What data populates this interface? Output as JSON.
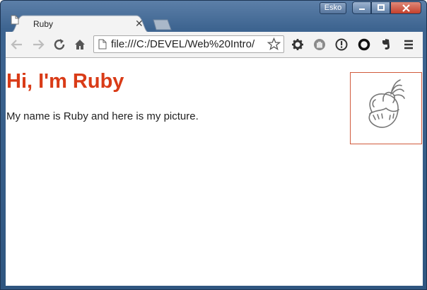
{
  "window": {
    "user_badge": "Esko",
    "controls": [
      "minimize",
      "maximize",
      "close"
    ]
  },
  "tabs": [
    {
      "title": "Ruby",
      "icon": "page-icon",
      "active": true
    }
  ],
  "toolbar": {
    "url": "file:///C:/DEVEL/Web%20Intro/",
    "nav_icons": [
      "back-arrow-icon",
      "forward-arrow-icon",
      "reload-icon",
      "home-icon"
    ],
    "extension_icons": [
      "gear-icon",
      "hand-icon",
      "info-icon",
      "ring-icon",
      "evernote-icon",
      "menu-icon"
    ]
  },
  "page": {
    "heading": "Hi, I'm Ruby",
    "paragraph": "My name is Ruby and here is my picture.",
    "picture_alt": "sketch of Ruby's face"
  },
  "colors": {
    "heading": "#d93b17",
    "picture_border": "#d05a3c",
    "frame": "#3d6490"
  }
}
